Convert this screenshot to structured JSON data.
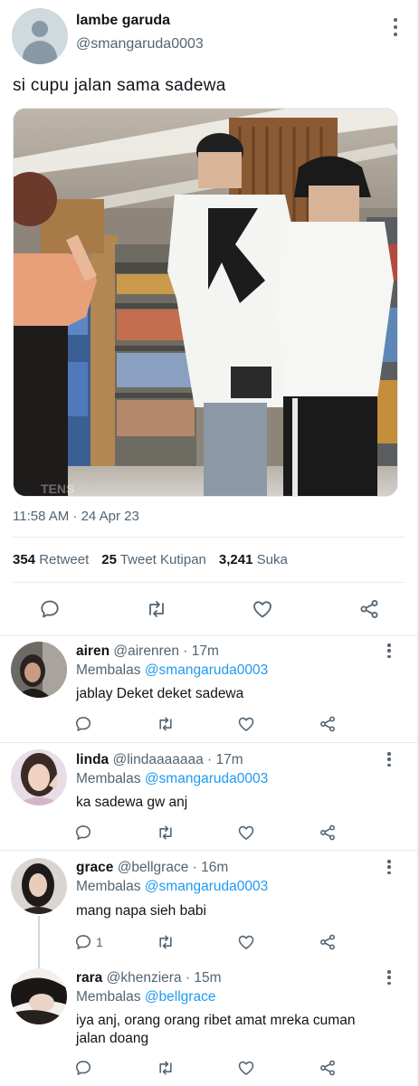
{
  "tweet": {
    "name": "lambe garuda",
    "handle": "@smangaruda0003",
    "text": "si cupu jalan sama sadewa",
    "timestamp": "11:58 AM · 24 Apr 23",
    "stats": {
      "retweets_count": "354",
      "retweets_label": "Retweet",
      "quotes_count": "25",
      "quotes_label": "Tweet Kutipan",
      "likes_count": "3,241",
      "likes_label": "Suka"
    }
  },
  "replies": [
    {
      "name": "airen",
      "handle": "@airenren",
      "time": "· 17m",
      "replying_label": "Membalas",
      "replying_to": "@smangaruda0003",
      "text": "jablay Deket deket sadewa",
      "reply_count": ""
    },
    {
      "name": "linda",
      "handle": "@lindaaaaaaa",
      "time": "· 17m",
      "replying_label": "Membalas",
      "replying_to": "@smangaruda0003",
      "text": "ka sadewa gw anj",
      "reply_count": ""
    },
    {
      "name": "grace",
      "handle": "@bellgrace",
      "time": "· 16m",
      "replying_label": "Membalas",
      "replying_to": "@smangaruda0003",
      "text": "mang napa sieh babi",
      "reply_count": "1"
    },
    {
      "name": "rara",
      "handle": "@khenziera",
      "time": "· 15m",
      "replying_label": "Membalas",
      "replying_to": "@bellgrace",
      "text": "iya anj, orang orang ribet amat mreka cuman jalan doang",
      "reply_count": ""
    }
  ],
  "icons": {
    "reply": "reply-icon",
    "retweet": "retweet-icon",
    "like": "heart-icon",
    "share": "share-icon",
    "more": "more-vertical-icon"
  },
  "colors": {
    "accent": "#1d9bf0",
    "secondary_text": "#536471",
    "divider": "#e6ecf0"
  }
}
